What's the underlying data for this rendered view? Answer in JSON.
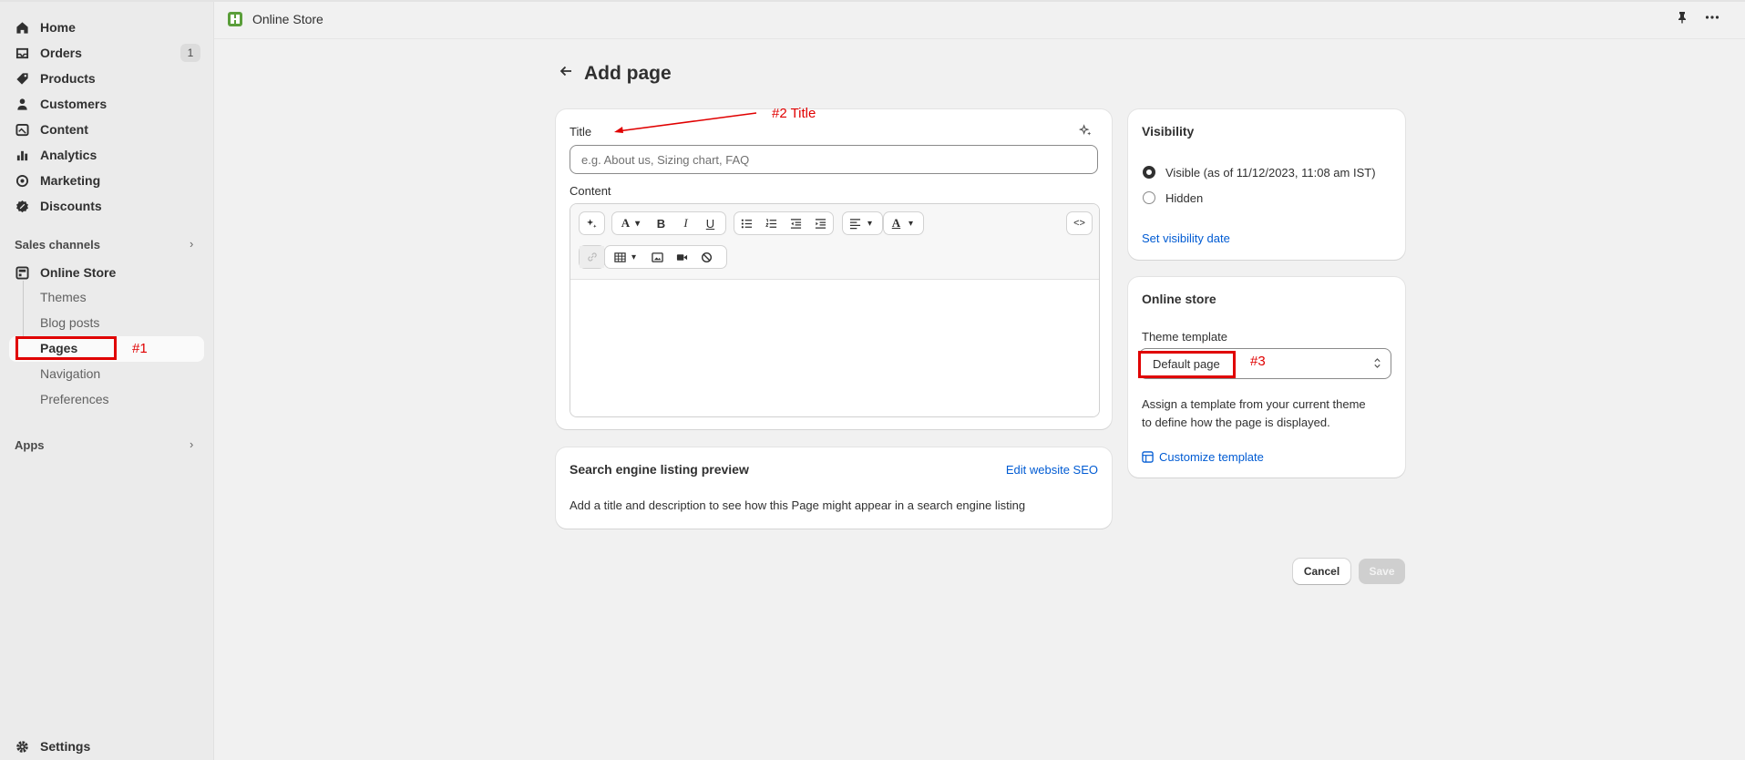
{
  "sidebar": {
    "nav": [
      {
        "label": "Home",
        "icon": "home-icon"
      },
      {
        "label": "Orders",
        "icon": "inbox-icon",
        "count": "1"
      },
      {
        "label": "Products",
        "icon": "tag-icon"
      },
      {
        "label": "Customers",
        "icon": "person-icon"
      },
      {
        "label": "Content",
        "icon": "image-icon"
      },
      {
        "label": "Analytics",
        "icon": "bar-chart-icon"
      },
      {
        "label": "Marketing",
        "icon": "target-icon"
      },
      {
        "label": "Discounts",
        "icon": "discount-icon"
      }
    ],
    "sales_channels_label": "Sales channels",
    "online_store_label": "Online Store",
    "sub_items": [
      "Themes",
      "Blog posts",
      "Pages",
      "Navigation",
      "Preferences"
    ],
    "apps_label": "Apps",
    "settings_label": "Settings"
  },
  "topbar": {
    "store_label": "Online Store"
  },
  "header": {
    "title": "Add page"
  },
  "main_card": {
    "title_label": "Title",
    "title_placeholder": "e.g. About us, Sizing chart, FAQ",
    "content_label": "Content",
    "code_button": "<>"
  },
  "seo_card": {
    "title": "Search engine listing preview",
    "edit_link": "Edit website SEO",
    "description": "Add a title and description to see how this Page might appear in a search engine listing"
  },
  "visibility_card": {
    "title": "Visibility",
    "visible_label": "Visible (as of 11/12/2023, 11:08 am IST)",
    "hidden_label": "Hidden",
    "set_date_link": "Set visibility date"
  },
  "online_store_card": {
    "title": "Online store",
    "template_label": "Theme template",
    "template_value": "Default page",
    "help_line1": "Assign a template from your current theme",
    "help_line2": "to define how the page is displayed.",
    "customize_link": "Customize template"
  },
  "actions": {
    "cancel": "Cancel",
    "save": "Save"
  },
  "annotations": {
    "note1": "#1",
    "note2": "#2 Title",
    "note3": "#3"
  },
  "colors": {
    "accent_link": "#005bd3",
    "annotation_red": "#e00000",
    "brand_green": "#5a9e3a"
  }
}
